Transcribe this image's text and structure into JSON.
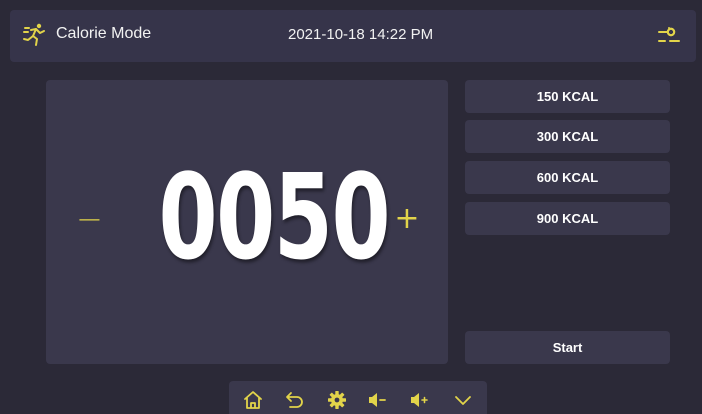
{
  "header": {
    "mode_title": "Calorie Mode",
    "datetime": "2021-10-18 14:22 PM",
    "mode_icon": "running-person-icon",
    "settings_icon": "sliders-icon"
  },
  "display": {
    "value": "0050",
    "decrease_label": "−",
    "increase_label": "+"
  },
  "presets": [
    {
      "label": "150 KCAL"
    },
    {
      "label": "300 KCAL"
    },
    {
      "label": "600 KCAL"
    },
    {
      "label": "900 KCAL"
    }
  ],
  "start": {
    "label": "Start"
  },
  "navbar": {
    "icons": [
      "home-icon",
      "back-icon",
      "gear-icon",
      "volume-down-icon",
      "volume-up-icon",
      "chevron-down-icon"
    ]
  },
  "colors": {
    "accent": "#e2d44a",
    "background": "#2b2937",
    "panel": "#36344a",
    "button": "#3a384c"
  }
}
